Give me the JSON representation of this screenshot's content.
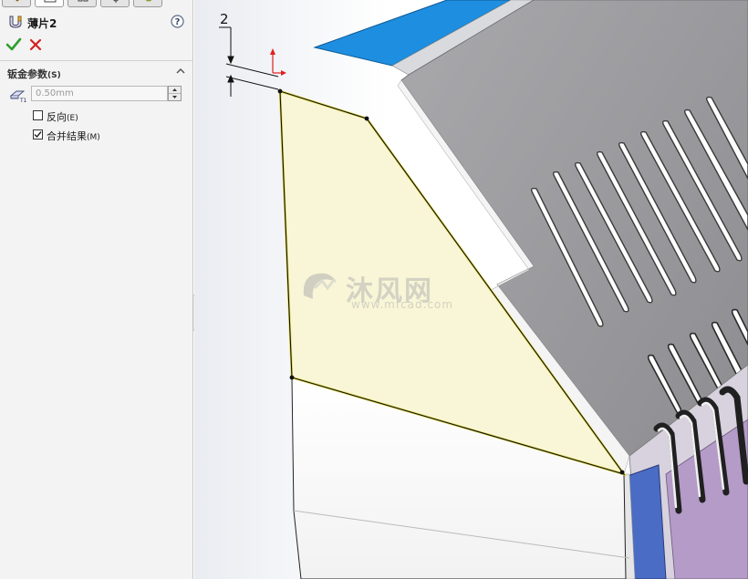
{
  "feature": {
    "title": "薄片2",
    "icon": "base-flange-icon"
  },
  "actions": {
    "ok_icon": "checkmark-icon",
    "cancel_icon": "close-x-icon",
    "help_icon": "help-icon"
  },
  "sheet_metal_group": {
    "title": "钣金参数",
    "title_shortcut": "(S)",
    "thickness_value": "0.50mm",
    "reverse_direction_label": "反向",
    "reverse_direction_shortcut": "(E)",
    "reverse_direction_checked": false,
    "merge_result_label": "合并结果",
    "merge_result_shortcut": "(M)",
    "merge_result_checked": true
  },
  "viewport": {
    "dimension_label": "2",
    "watermark_brand": "沐风网",
    "watermark_url": "www.mfcad.com"
  },
  "colors": {
    "accept_green": "#2e9e2e",
    "cancel_red": "#d42020",
    "preview_fill": "#f7f5d2",
    "preview_edge": "#e0d84a",
    "blue_flange": "#1e8fe0",
    "purple_face": "#b59bc8"
  }
}
